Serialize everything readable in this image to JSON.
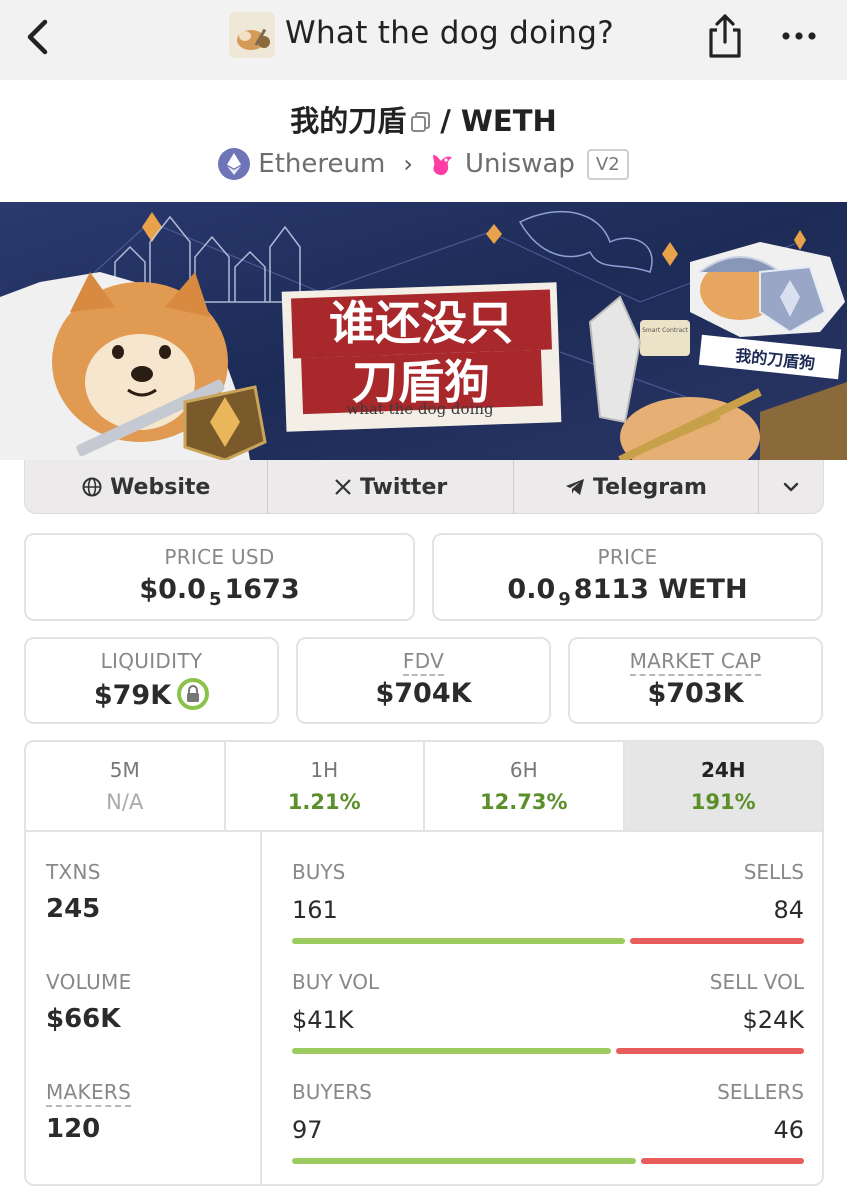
{
  "header": {
    "title": "What the dog doing?"
  },
  "pair": {
    "base": "我的刀盾",
    "separator": "/",
    "quote": "WETH",
    "chain": "Ethereum",
    "dex": "Uniswap",
    "version": "V2"
  },
  "banner": {
    "headline_line1": "谁还没只",
    "headline_line2": "刀盾狗",
    "tagline": "what the dog doing",
    "side_label": "我的刀盾狗",
    "scroll_label": "Smart Contract"
  },
  "links": {
    "website": "Website",
    "twitter": "Twitter",
    "telegram": "Telegram"
  },
  "prices": {
    "price_usd_label": "PRICE USD",
    "price_usd_prefix": "$0.0",
    "price_usd_zeros": "5",
    "price_usd_digits": "1673",
    "price_label": "PRICE",
    "price_prefix": "0.0",
    "price_zeros": "9",
    "price_digits": "8113 WETH"
  },
  "metrics": {
    "liquidity_label": "LIQUIDITY",
    "liquidity_value": "$79K",
    "fdv_label": "FDV",
    "fdv_value": "$704K",
    "mcap_label": "MARKET CAP",
    "mcap_value": "$703K"
  },
  "timeframes": [
    {
      "label": "5M",
      "value": "N/A"
    },
    {
      "label": "1H",
      "value": "1.21%"
    },
    {
      "label": "6H",
      "value": "12.73%"
    },
    {
      "label": "24H",
      "value": "191%"
    }
  ],
  "stats": {
    "txns_label": "TXNS",
    "txns_value": "245",
    "volume_label": "VOLUME",
    "volume_value": "$66K",
    "makers_label": "MAKERS",
    "makers_value": "120",
    "buys_label": "BUYS",
    "buys_value": "161",
    "sells_label": "SELLS",
    "sells_value": "84",
    "buy_vol_label": "BUY VOL",
    "buy_vol_value": "$41K",
    "sell_vol_label": "SELL VOL",
    "sell_vol_value": "$24K",
    "buyers_label": "BUYERS",
    "buyers_value": "97",
    "sellers_label": "SELLERS",
    "sellers_value": "46",
    "ratios": {
      "buys": 0.657,
      "buy_vol": 0.63,
      "buyers": 0.678
    }
  },
  "colors": {
    "positive": "#5a8f29",
    "buy_bar": "#9bcb5e",
    "sell_bar": "#e85c5c",
    "lock_ring": "#8bc34a"
  }
}
